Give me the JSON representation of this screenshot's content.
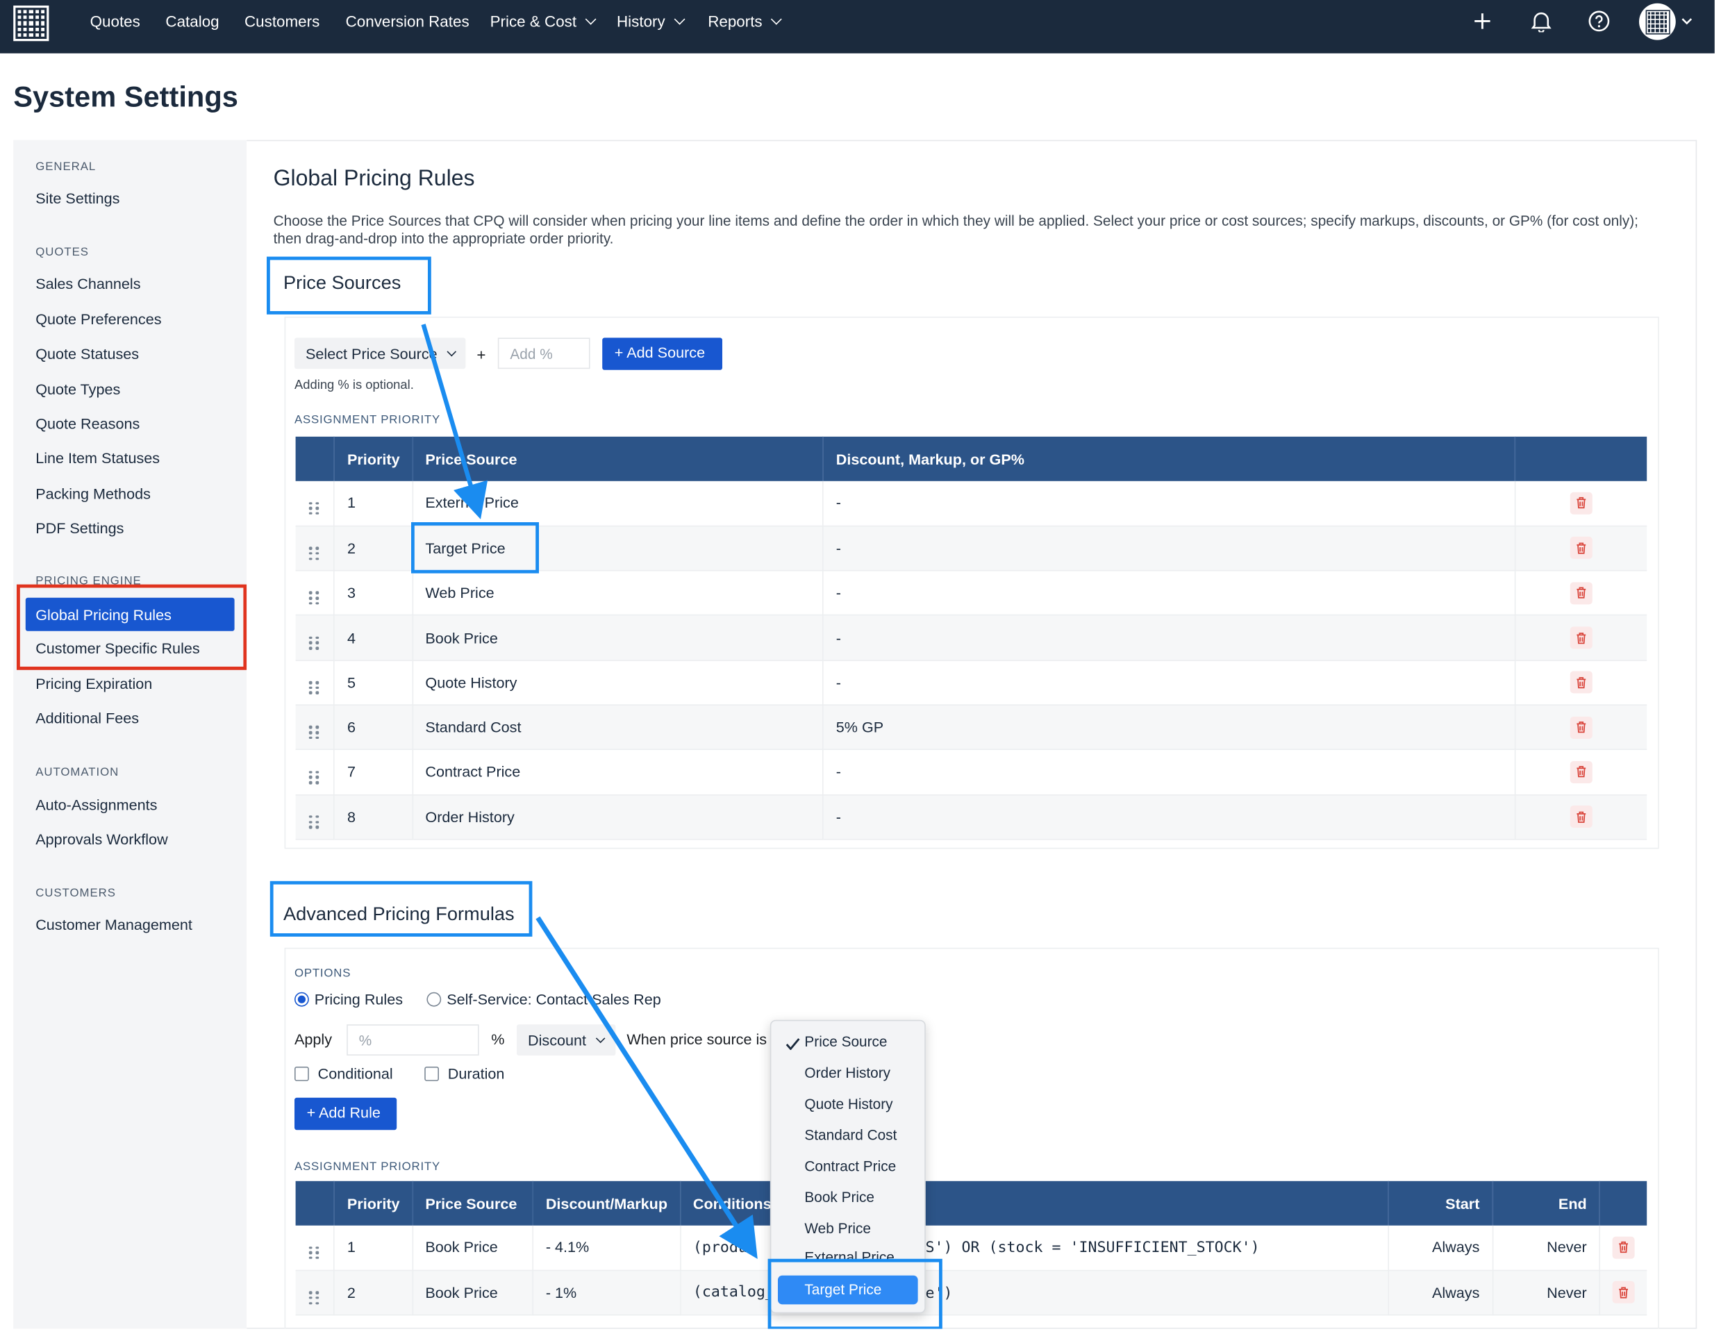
{
  "nav": {
    "items": [
      {
        "label": "Quotes"
      },
      {
        "label": "Catalog"
      },
      {
        "label": "Customers"
      },
      {
        "label": "Conversion Rates"
      },
      {
        "label": "Price & Cost"
      },
      {
        "label": "History"
      },
      {
        "label": "Reports"
      }
    ],
    "icons": [
      "plus-icon",
      "bell-icon",
      "help-icon",
      "avatar"
    ]
  },
  "page_title": "System Settings",
  "sidebar": {
    "general": {
      "header": "GENERAL",
      "items": [
        "Site Settings"
      ]
    },
    "quotes": {
      "header": "QUOTES",
      "items": [
        "Sales Channels",
        "Quote Preferences",
        "Quote Statuses",
        "Quote Types",
        "Quote Reasons",
        "Line Item Statuses",
        "Packing Methods",
        "PDF Settings"
      ]
    },
    "pricing": {
      "header": "PRICING ENGINE",
      "items": [
        "Global Pricing Rules",
        "Customer Specific Rules",
        "Pricing Expiration",
        "Additional Fees"
      ],
      "active": "Global Pricing Rules"
    },
    "automation": {
      "header": "AUTOMATION",
      "items": [
        "Auto-Assignments",
        "Approvals Workflow"
      ]
    },
    "customers": {
      "header": "CUSTOMERS",
      "items": [
        "Customer Management"
      ]
    }
  },
  "main": {
    "title": "Global Pricing Rules",
    "description": "Choose the Price Sources that CPQ will consider when pricing your line items and define the order in which they will be applied. Select your price or cost sources; specify markups, discounts, or GP% (for cost only); then drag-and-drop into the appropriate order priority.",
    "price_sources": {
      "heading": "Price Sources",
      "select_label": "Select Price Source",
      "plus": "+",
      "add_placeholder": "Add %",
      "add_button": "Add Source",
      "hint": "Adding % is optional.",
      "assignment_label": "ASSIGNMENT PRIORITY",
      "columns": [
        "Priority",
        "Price Source",
        "Discount, Markup, or GP%"
      ],
      "rows": [
        {
          "priority": "1",
          "source": "External Price",
          "adj": "-"
        },
        {
          "priority": "2",
          "source": "Target Price",
          "adj": "-"
        },
        {
          "priority": "3",
          "source": "Web Price",
          "adj": "-"
        },
        {
          "priority": "4",
          "source": "Book Price",
          "adj": "-"
        },
        {
          "priority": "5",
          "source": "Quote History",
          "adj": "-"
        },
        {
          "priority": "6",
          "source": "Standard Cost",
          "adj": "5% GP"
        },
        {
          "priority": "7",
          "source": "Contract Price",
          "adj": "-"
        },
        {
          "priority": "8",
          "source": "Order History",
          "adj": "-"
        }
      ]
    },
    "advanced": {
      "heading": "Advanced Pricing Formulas",
      "options_label": "OPTIONS",
      "radio1": "Pricing Rules",
      "radio2": "Self-Service: Contact Sales Rep",
      "apply_label": "Apply",
      "percent_placeholder": "%",
      "percent_suffix": "%",
      "discount_select": "Discount",
      "when_text": "When price source is",
      "check1": "Conditional",
      "check2": "Duration",
      "add_rule": "Add Rule",
      "assignment_label": "ASSIGNMENT PRIORITY",
      "columns": [
        "Priority",
        "Price Source",
        "Discount/Markup",
        "Conditions",
        "Start",
        "End"
      ],
      "rows": [
        {
          "priority": "1",
          "source": "Book Price",
          "dm": "- 4.1%",
          "cond_left": "(produ",
          "cond_right": "ES') OR (stock = 'INSUFFICIENT_STOCK')",
          "start": "Always",
          "end": "Never"
        },
        {
          "priority": "2",
          "source": "Book Price",
          "dm": "- 1%",
          "cond_left": "(catalog_",
          "cond_right": "ue')",
          "start": "Always",
          "end": "Never"
        }
      ]
    },
    "dropdown": {
      "options": [
        "Price Source",
        "Order History",
        "Quote History",
        "Standard Cost",
        "Contract Price",
        "Book Price",
        "Web Price",
        "External Price",
        "Target Price"
      ],
      "checked": "Price Source",
      "highlighted": "Target Price"
    }
  },
  "colors": {
    "topbar": "#1b2a3d",
    "accent": "#1857d0",
    "table_header": "#2c5488",
    "annotation_blue": "#1a8cf0",
    "annotation_red": "#e0341f"
  }
}
